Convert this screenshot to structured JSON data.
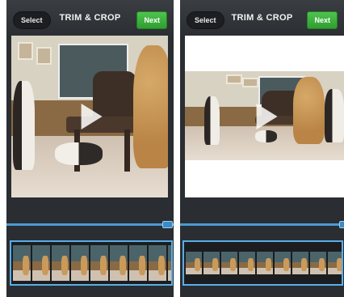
{
  "screens": [
    {
      "id": "original",
      "header": {
        "select_label": "Select",
        "title": "TRIM & CROP",
        "next_label": "Next"
      },
      "preview": {
        "mode": "full"
      },
      "trim": {
        "handle_position": 1.0
      },
      "filmstrip": {
        "frames": 9
      }
    },
    {
      "id": "cropped",
      "header": {
        "select_label": "Select",
        "title": "TRIM & CROP",
        "next_label": "Next"
      },
      "preview": {
        "mode": "letterboxed"
      },
      "trim": {
        "handle_position": 1.0
      },
      "filmstrip": {
        "frames": 10
      }
    }
  ],
  "colors": {
    "accent_blue": "#4a9bd4",
    "next_green": "#3bb33d",
    "toolbar_dark": "#2b2e32"
  },
  "icons": {
    "play": "play-icon"
  }
}
